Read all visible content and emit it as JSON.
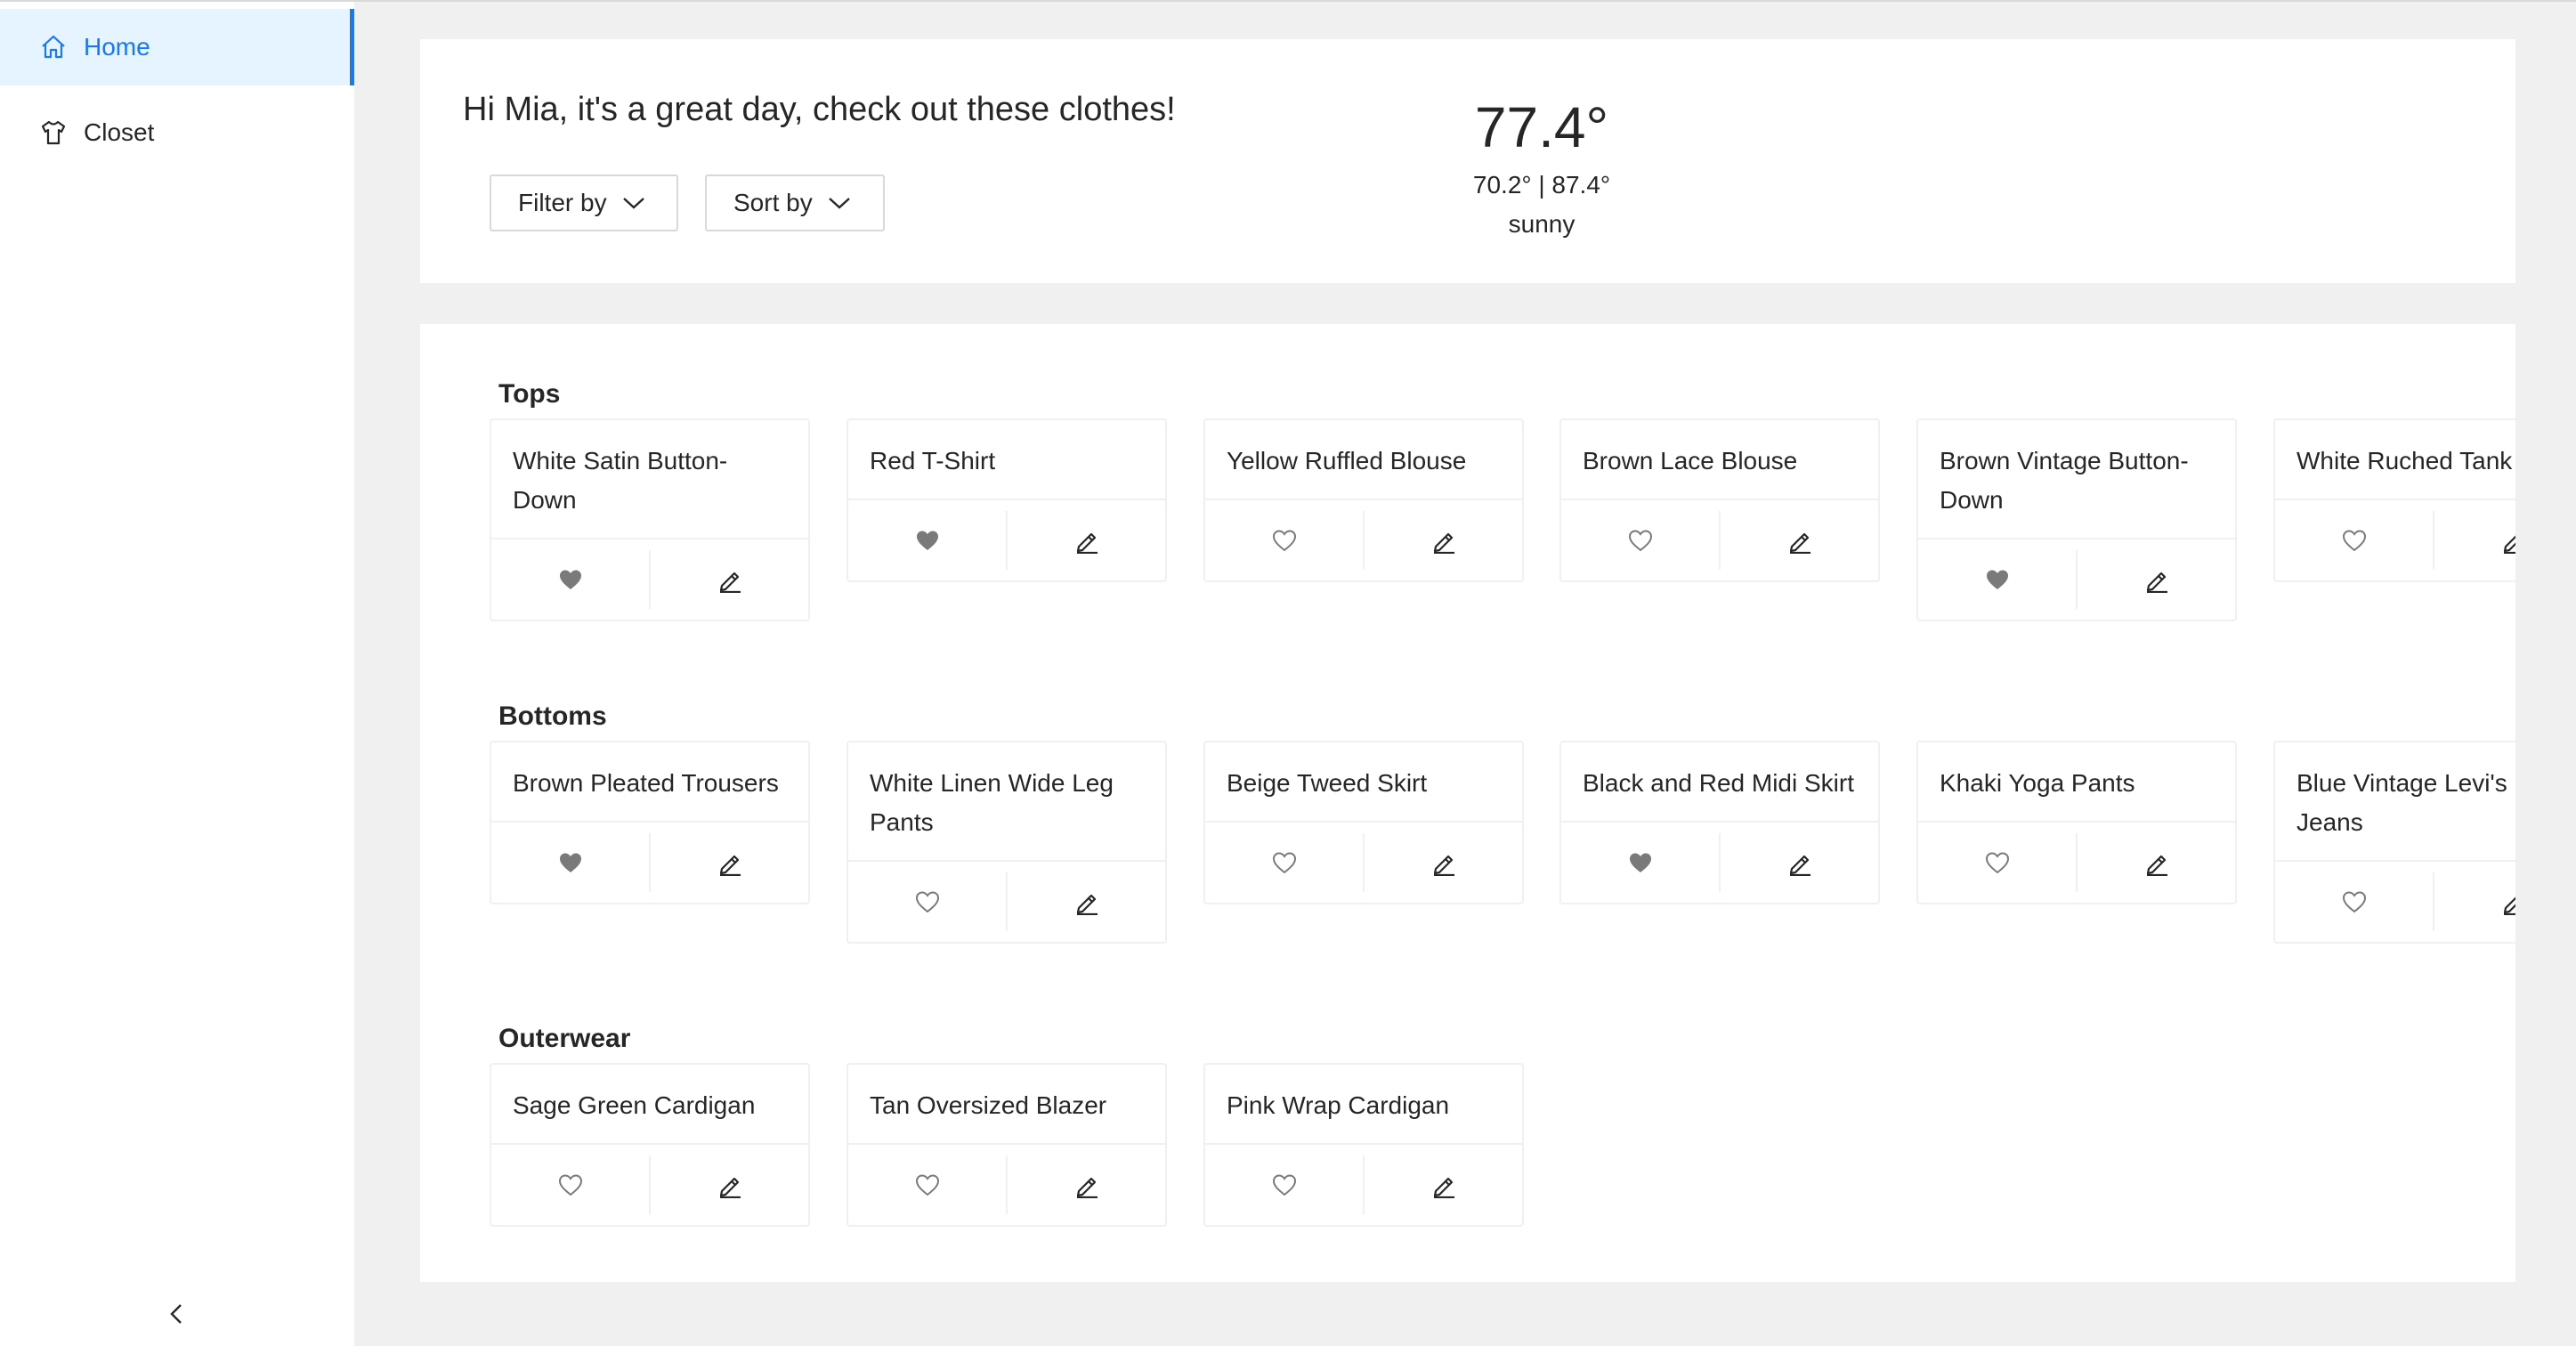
{
  "sidebar": {
    "items": [
      {
        "label": "Home",
        "icon": "home-icon",
        "active": true
      },
      {
        "label": "Closet",
        "icon": "shirt-icon",
        "active": false
      }
    ],
    "collapse_icon": "chevron-left-icon"
  },
  "header": {
    "greeting": "Hi Mia, it's a great day, check out these clothes!",
    "filter_label": "Filter by",
    "sort_label": "Sort by"
  },
  "weather": {
    "temperature": "77.4°",
    "range": "70.2° | 87.4°",
    "condition": "sunny"
  },
  "colors": {
    "accent": "#1677ff",
    "active_bg": "#e6f4ff",
    "heart_filled": "#7a7a7a"
  },
  "sections": [
    {
      "title": "Tops",
      "items": [
        {
          "name": "White Satin Button-Down",
          "favorite": true
        },
        {
          "name": "Red T-Shirt",
          "favorite": true
        },
        {
          "name": "Yellow Ruffled Blouse",
          "favorite": false
        },
        {
          "name": "Brown Lace Blouse",
          "favorite": false
        },
        {
          "name": "Brown Vintage Button-Down",
          "favorite": true
        },
        {
          "name": "White Ruched Tank",
          "favorite": false
        }
      ]
    },
    {
      "title": "Bottoms",
      "items": [
        {
          "name": "Brown Pleated Trousers",
          "favorite": true
        },
        {
          "name": "White Linen Wide Leg Pants",
          "favorite": false
        },
        {
          "name": "Beige Tweed Skirt",
          "favorite": false
        },
        {
          "name": "Black and Red Midi Skirt",
          "favorite": true
        },
        {
          "name": "Khaki Yoga Pants",
          "favorite": false
        },
        {
          "name": "Blue Vintage Levi's Jeans",
          "favorite": false
        }
      ]
    },
    {
      "title": "Outerwear",
      "items": [
        {
          "name": "Sage Green Cardigan",
          "favorite": false
        },
        {
          "name": "Tan Oversized Blazer",
          "favorite": false
        },
        {
          "name": "Pink Wrap Cardigan",
          "favorite": false
        }
      ]
    }
  ]
}
